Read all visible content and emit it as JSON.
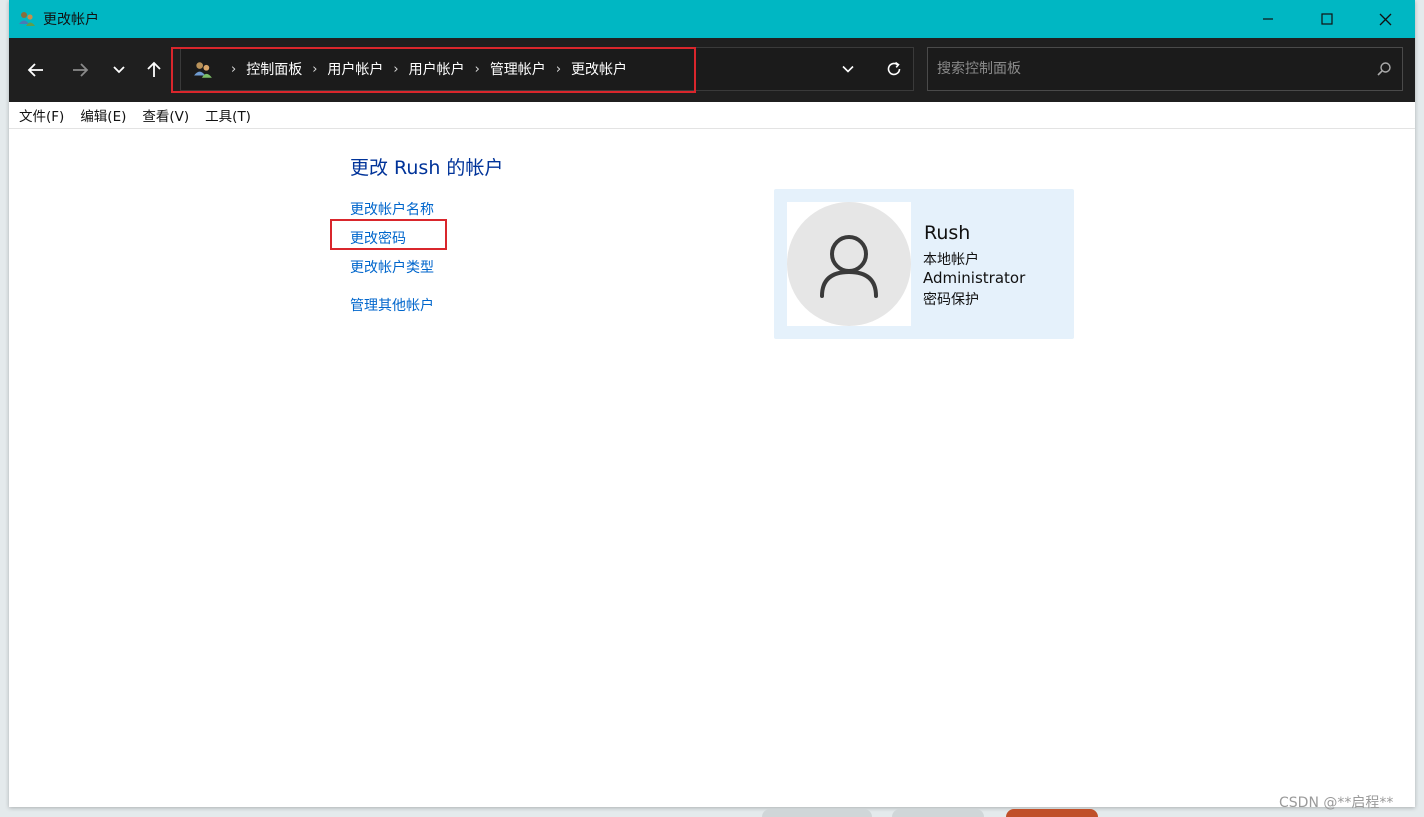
{
  "window": {
    "title": "更改帐户"
  },
  "nav": {
    "breadcrumbs": [
      "控制面板",
      "用户帐户",
      "用户帐户",
      "管理帐户",
      "更改帐户"
    ]
  },
  "search": {
    "placeholder": "搜索控制面板"
  },
  "menu": [
    "文件(F)",
    "编辑(E)",
    "查看(V)",
    "工具(T)"
  ],
  "content": {
    "title": "更改 Rush 的帐户",
    "links": {
      "rename": "更改帐户名称",
      "password": "更改密码",
      "type": "更改帐户类型",
      "manage": "管理其他帐户"
    }
  },
  "account": {
    "name": "Rush",
    "type": "本地帐户",
    "role": "Administrator",
    "protection": "密码保护"
  },
  "watermark": "CSDN @**启程**",
  "colors": {
    "titlebar": "#00b7c3",
    "navbar": "#1f1f1f",
    "link": "#0066cc",
    "highlight": "#d9262c",
    "card": "#e5f1fb"
  }
}
